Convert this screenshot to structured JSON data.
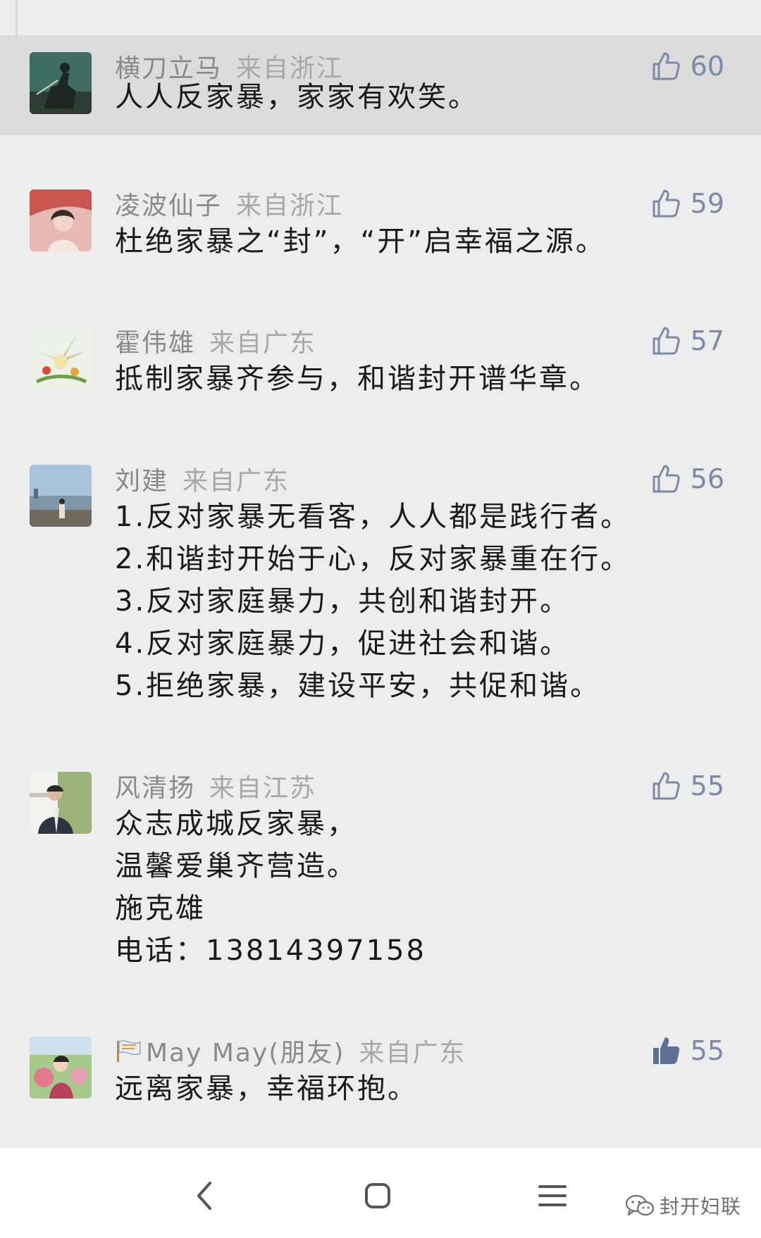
{
  "comments": [
    {
      "name": "横刀立马",
      "region": "来自浙江",
      "likes": "60",
      "lines": [
        "人人反家暴，家家有欢笑。"
      ]
    },
    {
      "name": "凌波仙子",
      "region": "来自浙江",
      "likes": "59",
      "lines": [
        "杜绝家暴之“封”，“开”启幸福之源。"
      ]
    },
    {
      "name": "霍伟雄",
      "region": "来自广东",
      "likes": "57",
      "lines": [
        "抵制家暴齐参与，和谐封开谱华章。"
      ]
    },
    {
      "name": "刘建",
      "region": "来自广东",
      "likes": "56",
      "lines": [
        "1.反对家暴无看客，人人都是践行者。",
        "2.和谐封开始于心，反对家暴重在行。",
        "3.反对家庭暴力，共创和谐封开。",
        "4.反对家庭暴力，促进社会和谐。",
        "5.拒绝家暴，建设平安，共促和谐。"
      ]
    },
    {
      "name": "风清扬",
      "region": "来自江苏",
      "likes": "55",
      "lines": [
        "众志成城反家暴，",
        "温馨爱巢齐营造。",
        "施克雄",
        "电话：13814397158"
      ]
    },
    {
      "name": "May May(朋友)",
      "region": "来自广东",
      "likes": "55",
      "lines": [
        "远离家暴，幸福环抱。"
      ]
    }
  ],
  "watermark": {
    "text": "封开妇联"
  },
  "colors": {
    "like_outline": "#7c8aa6",
    "like_filled": "#5d6f95",
    "background": "#ededed",
    "highlight": "#dcdcdc"
  }
}
